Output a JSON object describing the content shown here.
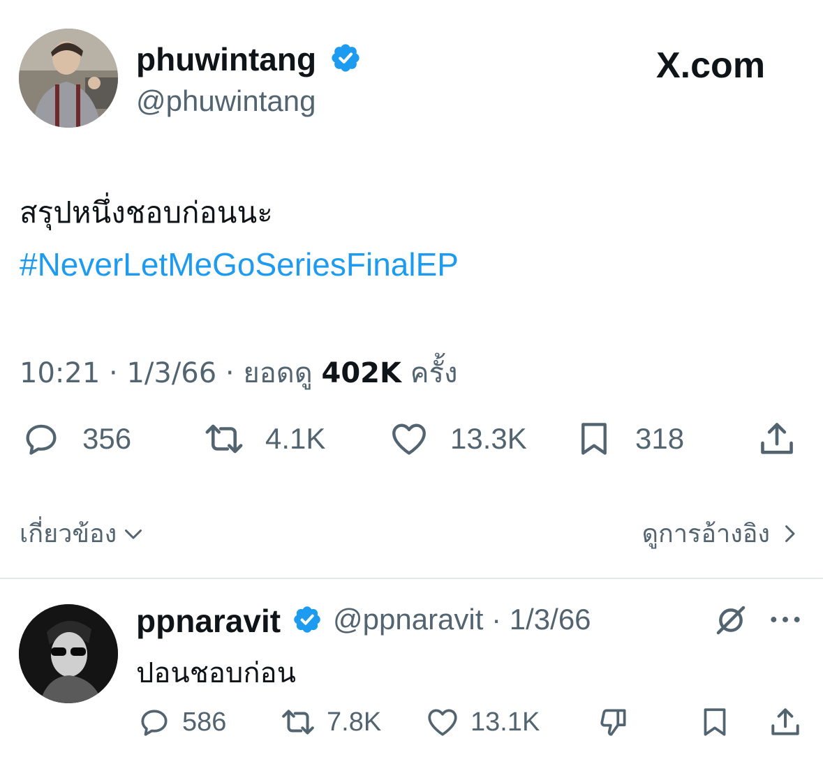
{
  "tweet": {
    "author": {
      "display_name": "phuwintang",
      "handle": "@phuwintang",
      "verified_icon": "verified-badge-icon"
    },
    "brand": "X.com",
    "text": "สรุปหนึ่งชอบก่อนนะ",
    "hashtag": "#NeverLetMeGoSeriesFinalEP",
    "meta": {
      "time": "10:21",
      "date": "1/3/66",
      "views_prefix": "ยอดดู",
      "views_count": "402K",
      "views_suffix": "ครั้ง",
      "separator": "·"
    },
    "actions": {
      "replies": "356",
      "reposts": "4.1K",
      "likes": "13.3K",
      "bookmarks": "318"
    },
    "related_label": "เกี่ยวข้อง",
    "quotes_label": "ดูการอ้างอิง"
  },
  "reply": {
    "display_name": "ppnaravit",
    "handle": "@ppnaravit",
    "separator": "·",
    "date": "1/3/66",
    "text": "ปอนชอบก่อน",
    "actions": {
      "replies": "586",
      "reposts": "7.8K",
      "likes": "13.1K"
    }
  },
  "colors": {
    "text": "#0f1419",
    "secondary": "#536471",
    "link": "#1d9bf0",
    "verified": "#1d9bf0",
    "divider": "#e1e8ed"
  }
}
